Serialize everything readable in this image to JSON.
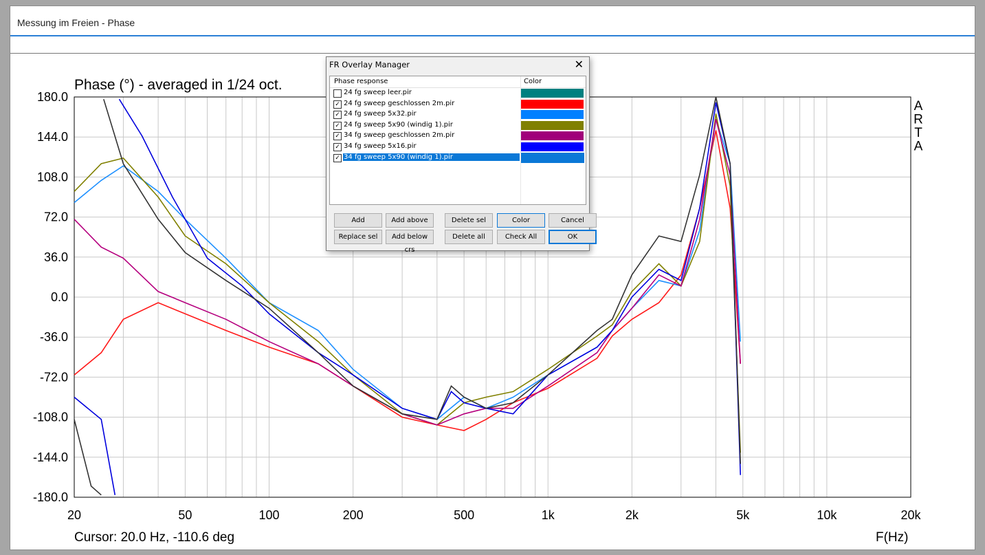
{
  "window": {
    "title": "Messung im Freien - Phase"
  },
  "chart_data": {
    "type": "line",
    "title": "Phase (°) - averaged in 1/24 oct.",
    "xlabel": "F(Hz)",
    "ylabel": "",
    "x_scale": "log",
    "xlim": [
      20,
      20000
    ],
    "ylim": [
      -180,
      180
    ],
    "grid": true,
    "yticks": [
      "180.0",
      "144.0",
      "108.0",
      "72.0",
      "36.0",
      "0.0",
      "-36.0",
      "-72.0",
      "-108.0",
      "-144.0",
      "-180.0"
    ],
    "xticks": [
      {
        "value": 20,
        "label": "20"
      },
      {
        "value": 50,
        "label": "50"
      },
      {
        "value": 100,
        "label": "100"
      },
      {
        "value": 200,
        "label": "200"
      },
      {
        "value": 500,
        "label": "500"
      },
      {
        "value": 1000,
        "label": "1k"
      },
      {
        "value": 2000,
        "label": "2k"
      },
      {
        "value": 5000,
        "label": "5k"
      },
      {
        "value": 10000,
        "label": "10k"
      },
      {
        "value": 20000,
        "label": "20k"
      }
    ],
    "watermark": "ARTA",
    "cursor_text": "Cursor: 20.0 Hz, -110.6 deg",
    "series": [
      {
        "name": "24 fg sweep geschlossen 2m.pir",
        "color": "#ff1a1a",
        "points": [
          [
            20,
            -70
          ],
          [
            25,
            -50
          ],
          [
            30,
            -20
          ],
          [
            40,
            -5
          ],
          [
            50,
            -15
          ],
          [
            70,
            -30
          ],
          [
            100,
            -45
          ],
          [
            150,
            -60
          ],
          [
            200,
            -80
          ],
          [
            300,
            -108
          ],
          [
            400,
            -115
          ],
          [
            500,
            -120
          ],
          [
            600,
            -110
          ],
          [
            750,
            -95
          ],
          [
            1000,
            -82
          ],
          [
            1500,
            -55
          ],
          [
            1700,
            -35
          ],
          [
            2000,
            -20
          ],
          [
            2500,
            -5
          ],
          [
            3000,
            20
          ],
          [
            3500,
            80
          ],
          [
            4000,
            150
          ],
          [
            4500,
            80
          ],
          [
            4900,
            -60
          ]
        ]
      },
      {
        "name": "24 fg sweep 5x32.pir",
        "color": "#1e90ff",
        "points": [
          [
            20,
            85
          ],
          [
            25,
            105
          ],
          [
            30,
            118
          ],
          [
            40,
            95
          ],
          [
            50,
            70
          ],
          [
            70,
            35
          ],
          [
            100,
            -5
          ],
          [
            150,
            -30
          ],
          [
            200,
            -65
          ],
          [
            300,
            -100
          ],
          [
            400,
            -110
          ],
          [
            500,
            -90
          ],
          [
            600,
            -100
          ],
          [
            750,
            -90
          ],
          [
            1000,
            -70
          ],
          [
            1500,
            -45
          ],
          [
            1700,
            -30
          ],
          [
            2000,
            -10
          ],
          [
            2500,
            15
          ],
          [
            3000,
            10
          ],
          [
            3500,
            60
          ],
          [
            4000,
            160
          ],
          [
            4500,
            120
          ],
          [
            4900,
            -40
          ]
        ]
      },
      {
        "name": "24 fg sweep 5x90 (windig 1).pir",
        "color": "#808000",
        "points": [
          [
            20,
            95
          ],
          [
            25,
            120
          ],
          [
            30,
            125
          ],
          [
            40,
            90
          ],
          [
            50,
            55
          ],
          [
            70,
            30
          ],
          [
            100,
            -5
          ],
          [
            150,
            -40
          ],
          [
            200,
            -70
          ],
          [
            300,
            -105
          ],
          [
            400,
            -115
          ],
          [
            500,
            -95
          ],
          [
            600,
            -90
          ],
          [
            750,
            -85
          ],
          [
            1000,
            -65
          ],
          [
            1500,
            -35
          ],
          [
            1700,
            -25
          ],
          [
            2000,
            5
          ],
          [
            2500,
            30
          ],
          [
            3000,
            10
          ],
          [
            3500,
            50
          ],
          [
            4000,
            165
          ],
          [
            4500,
            100
          ],
          [
            4900,
            -140
          ]
        ]
      },
      {
        "name": "34 fg sweep geschlossen 2m.pir",
        "color": "#b5007e",
        "points": [
          [
            20,
            70
          ],
          [
            25,
            45
          ],
          [
            30,
            35
          ],
          [
            40,
            5
          ],
          [
            50,
            -5
          ],
          [
            70,
            -20
          ],
          [
            100,
            -40
          ],
          [
            150,
            -60
          ],
          [
            200,
            -80
          ],
          [
            300,
            -105
          ],
          [
            400,
            -115
          ],
          [
            500,
            -105
          ],
          [
            600,
            -100
          ],
          [
            750,
            -100
          ],
          [
            1000,
            -80
          ],
          [
            1500,
            -50
          ],
          [
            1700,
            -30
          ],
          [
            2000,
            -10
          ],
          [
            2500,
            20
          ],
          [
            3000,
            10
          ],
          [
            3500,
            70
          ],
          [
            4000,
            160
          ],
          [
            4500,
            110
          ],
          [
            4900,
            -60
          ]
        ]
      },
      {
        "name": "34 fg sweep 5x16.pir",
        "color": "#0000dd",
        "points": [
          [
            20,
            -90
          ],
          [
            25,
            -110
          ],
          [
            28,
            -178
          ],
          [
            29,
            178
          ],
          [
            35,
            145
          ],
          [
            45,
            90
          ],
          [
            60,
            35
          ],
          [
            80,
            10
          ],
          [
            100,
            -15
          ],
          [
            150,
            -50
          ],
          [
            200,
            -70
          ],
          [
            300,
            -100
          ],
          [
            400,
            -110
          ],
          [
            450,
            -85
          ],
          [
            500,
            -95
          ],
          [
            600,
            -100
          ],
          [
            750,
            -105
          ],
          [
            1000,
            -70
          ],
          [
            1500,
            -45
          ],
          [
            1700,
            -30
          ],
          [
            2000,
            0
          ],
          [
            2500,
            25
          ],
          [
            3000,
            15
          ],
          [
            3500,
            80
          ],
          [
            4000,
            175
          ],
          [
            4500,
            120
          ],
          [
            4900,
            -160
          ]
        ]
      },
      {
        "name": "24 fg sweep leer.pir",
        "color": "#333333",
        "points": [
          [
            20,
            -110
          ],
          [
            23,
            -170
          ],
          [
            25,
            -178
          ],
          [
            25.5,
            178
          ],
          [
            30,
            120
          ],
          [
            40,
            70
          ],
          [
            50,
            40
          ],
          [
            70,
            15
          ],
          [
            100,
            -10
          ],
          [
            150,
            -50
          ],
          [
            200,
            -80
          ],
          [
            300,
            -105
          ],
          [
            400,
            -110
          ],
          [
            450,
            -80
          ],
          [
            500,
            -90
          ],
          [
            600,
            -100
          ],
          [
            750,
            -95
          ],
          [
            1000,
            -70
          ],
          [
            1500,
            -30
          ],
          [
            1700,
            -20
          ],
          [
            2000,
            20
          ],
          [
            2500,
            55
          ],
          [
            3000,
            50
          ],
          [
            3500,
            110
          ],
          [
            4000,
            180
          ],
          [
            4500,
            120
          ],
          [
            4900,
            -150
          ]
        ]
      }
    ]
  },
  "dialog": {
    "title": "FR Overlay Manager",
    "close_glyph": "✕",
    "header_name": "Phase response",
    "header_color": "Color",
    "items": [
      {
        "label": "24 fg sweep leer.pir",
        "checked": false,
        "color": "#008080",
        "selected": false
      },
      {
        "label": "24 fg sweep geschlossen 2m.pir",
        "checked": true,
        "color": "#ff0000",
        "selected": false
      },
      {
        "label": "24 fg sweep 5x32.pir",
        "checked": true,
        "color": "#0080ff",
        "selected": false
      },
      {
        "label": "24 fg sweep 5x90 (windig 1).pir",
        "checked": true,
        "color": "#808000",
        "selected": false
      },
      {
        "label": "34 fg sweep geschlossen 2m.pir",
        "checked": true,
        "color": "#a0007a",
        "selected": false
      },
      {
        "label": "34 fg sweep 5x16.pir",
        "checked": true,
        "color": "#0000ff",
        "selected": false
      },
      {
        "label": "34 fg sweep 5x90 (windig 1).pir",
        "checked": true,
        "color": "#0a78d7",
        "selected": true
      }
    ],
    "buttons_row1": [
      "Add",
      "Add above crs",
      "Delete sel",
      "Color",
      "Cancel"
    ],
    "buttons_row2": [
      "Replace sel",
      "Add below crs",
      "Delete all",
      "Check All",
      "OK"
    ]
  }
}
